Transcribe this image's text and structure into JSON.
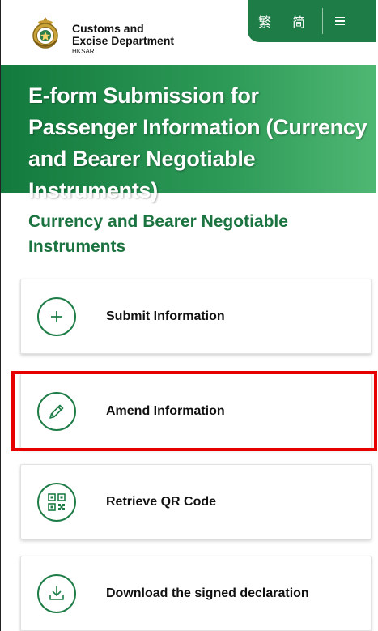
{
  "header": {
    "brand_line1": "Customs and",
    "brand_line2": "Excise Department",
    "brand_line3": "HKSAR",
    "lang_traditional": "繁",
    "lang_simplified": "简",
    "menu_icon": "hamburger-menu-icon",
    "accent_color": "#1e7d47"
  },
  "banner": {
    "title": "E-form Submission for Passenger Information (Currency and Bearer Negotiable Instruments)"
  },
  "section": {
    "title": "Currency and Bearer Negotiable Instruments"
  },
  "actions": [
    {
      "label": "Submit Information",
      "icon": "plus-icon"
    },
    {
      "label": "Amend Information",
      "icon": "pencil-icon",
      "highlighted": true
    },
    {
      "label": "Retrieve QR Code",
      "icon": "qr-code-icon"
    },
    {
      "label": "Download the signed declaration",
      "icon": "download-icon"
    }
  ],
  "highlight_color": "#e60000"
}
